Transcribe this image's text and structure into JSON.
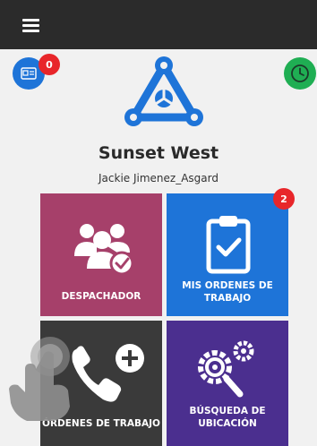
{
  "header": {
    "menu_icon": "hamburger-menu-icon"
  },
  "top": {
    "card_icon": "id-card-icon",
    "card_badge": "0",
    "clock_icon": "clock-icon"
  },
  "brand": {
    "logo_icon": "triangle-network-logo",
    "title": "Sunset West",
    "user": "Jackie Jimenez_Asgard"
  },
  "tiles": [
    {
      "label": "DESPACHADOR",
      "icon": "users-check-icon",
      "color": "#a6406a"
    },
    {
      "label": "MIS ORDENES DE TRABAJO",
      "icon": "clipboard-check-icon",
      "color": "#1e74d8",
      "badge": "2"
    },
    {
      "label": "ÓRDENES DE TRABAJO",
      "icon": "phone-plus-icon",
      "color": "#3a3a3a"
    },
    {
      "label": "BÚSQUEDA DE UBICACIÓN",
      "icon": "gear-search-icon",
      "color": "#4b2f8f"
    }
  ],
  "overlay": {
    "icon": "tap-hand-icon"
  }
}
